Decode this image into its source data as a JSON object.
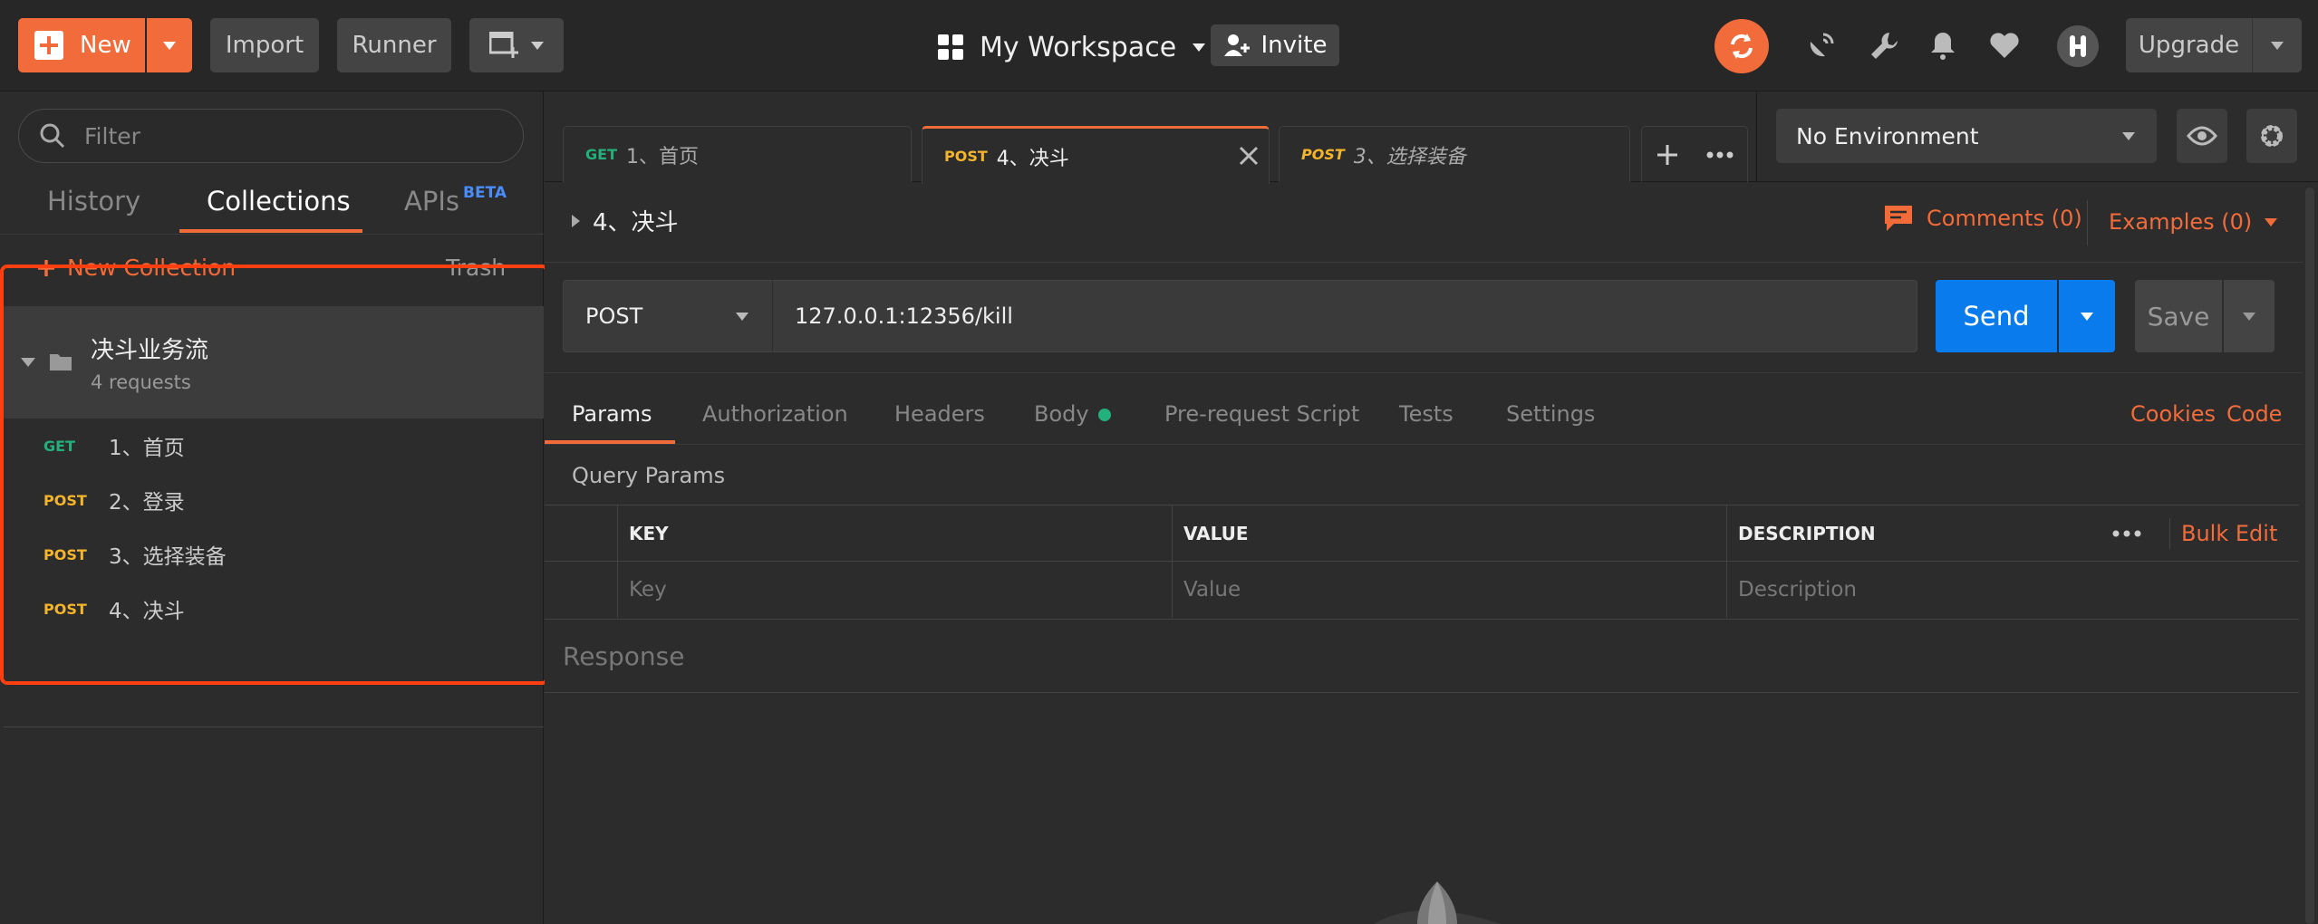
{
  "topbar": {
    "new_label": "New",
    "import_label": "Import",
    "runner_label": "Runner",
    "workspace_label": "My Workspace",
    "invite_label": "Invite",
    "upgrade_label": "Upgrade",
    "accent_color": "#f26b3a"
  },
  "sidebar": {
    "filter_placeholder": "Filter",
    "tabs": [
      {
        "label": "History"
      },
      {
        "label": "Collections"
      },
      {
        "label": "APIs",
        "badge": "BETA"
      }
    ],
    "new_collection_label": "New Collection",
    "trash_label": "Trash",
    "collection": {
      "name": "决斗业务流",
      "count": "4 requests",
      "requests": [
        {
          "method": "GET",
          "name": "1、首页"
        },
        {
          "method": "POST",
          "name": "2、登录"
        },
        {
          "method": "POST",
          "name": "3、选择装备"
        },
        {
          "method": "POST",
          "name": "4、决斗"
        }
      ]
    }
  },
  "tabs": [
    {
      "method": "GET",
      "name": "1、首页"
    },
    {
      "method": "POST",
      "name": "4、决斗"
    },
    {
      "method": "POST",
      "name": "3、选择装备"
    }
  ],
  "environment": {
    "selected": "No Environment"
  },
  "request": {
    "title": "4、决斗",
    "comments_label": "Comments (0)",
    "examples_label": "Examples (0)",
    "method": "POST",
    "url": "127.0.0.1:12356/kill",
    "send_label": "Send",
    "save_label": "Save"
  },
  "subtabs": [
    {
      "label": "Params"
    },
    {
      "label": "Authorization"
    },
    {
      "label": "Headers"
    },
    {
      "label": "Body"
    },
    {
      "label": "Pre-request Script"
    },
    {
      "label": "Tests"
    },
    {
      "label": "Settings"
    }
  ],
  "links": {
    "cookies": "Cookies",
    "code": "Code"
  },
  "query_params": {
    "title": "Query Params",
    "headers": {
      "key": "KEY",
      "value": "VALUE",
      "description": "DESCRIPTION"
    },
    "bulk_edit": "Bulk Edit",
    "placeholders": {
      "key": "Key",
      "value": "Value",
      "description": "Description"
    }
  },
  "response": {
    "label": "Response"
  }
}
